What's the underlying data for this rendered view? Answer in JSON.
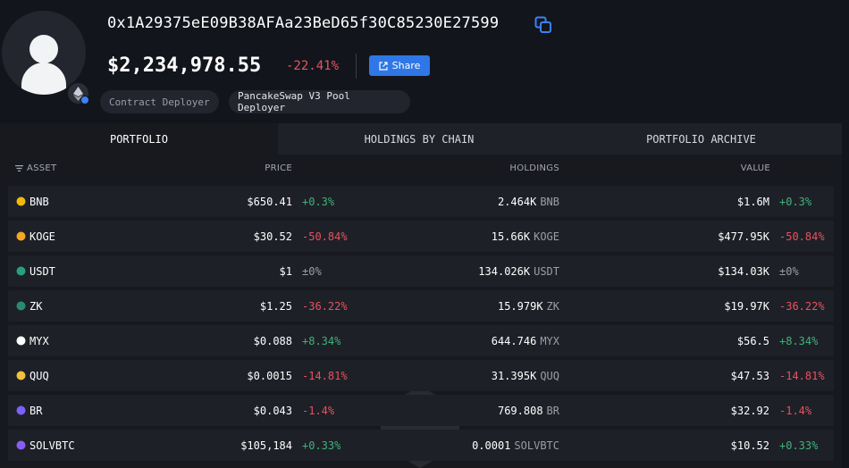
{
  "profile": {
    "address": "0x1A29375eE09B38AFAa23BeD65f30C85230E27599",
    "balance": "$2,234,978.55",
    "balance_change": "-22.41%",
    "share_label": "Share",
    "tags": [
      "Contract Deployer",
      "PancakeSwap V3 Pool Deployer"
    ]
  },
  "tabs": [
    {
      "label": "PORTFOLIO",
      "active": true
    },
    {
      "label": "HOLDINGS BY CHAIN",
      "active": false
    },
    {
      "label": "PORTFOLIO ARCHIVE",
      "active": false
    }
  ],
  "columns": {
    "asset": "ASSET",
    "price": "PRICE",
    "holdings": "HOLDINGS",
    "value": "VALUE"
  },
  "assets": [
    {
      "symbol": "BNB",
      "price": "$650.41",
      "price_change": "+0.3%",
      "holdings": "2.464K",
      "unit": "BNB",
      "value": "$1.6M",
      "value_change": "+0.3%",
      "icon_color": "#f0b90b"
    },
    {
      "symbol": "KOGE",
      "price": "$30.52",
      "price_change": "-50.84%",
      "holdings": "15.66K",
      "unit": "KOGE",
      "value": "$477.95K",
      "value_change": "-50.84%",
      "icon_color": "#f5a623"
    },
    {
      "symbol": "USDT",
      "price": "$1",
      "price_change": "±0%",
      "holdings": "134.026K",
      "unit": "USDT",
      "value": "$134.03K",
      "value_change": "±0%",
      "icon_color": "#26a17b"
    },
    {
      "symbol": "ZK",
      "price": "$1.25",
      "price_change": "-36.22%",
      "holdings": "15.979K",
      "unit": "ZK",
      "value": "$19.97K",
      "value_change": "-36.22%",
      "icon_color": "#2a8c6f"
    },
    {
      "symbol": "MYX",
      "price": "$0.088",
      "price_change": "+8.34%",
      "holdings": "644.746",
      "unit": "MYX",
      "value": "$56.5",
      "value_change": "+8.34%",
      "icon_color": "#ffffff"
    },
    {
      "symbol": "QUQ",
      "price": "$0.0015",
      "price_change": "-14.81%",
      "holdings": "31.395K",
      "unit": "QUQ",
      "value": "$47.53",
      "value_change": "-14.81%",
      "icon_color": "#f3c23c"
    },
    {
      "symbol": "BR",
      "price": "$0.043",
      "price_change": "-1.4%",
      "holdings": "769.808",
      "unit": "BR",
      "value": "$32.92",
      "value_change": "-1.4%",
      "icon_color": "#7b61ff"
    },
    {
      "symbol": "SOLVBTC",
      "price": "$105,184",
      "price_change": "+0.33%",
      "holdings": "0.0001",
      "unit": "SOLVBTC",
      "value": "$10.52",
      "value_change": "+0.33%",
      "icon_color": "#8a5cf6"
    }
  ]
}
